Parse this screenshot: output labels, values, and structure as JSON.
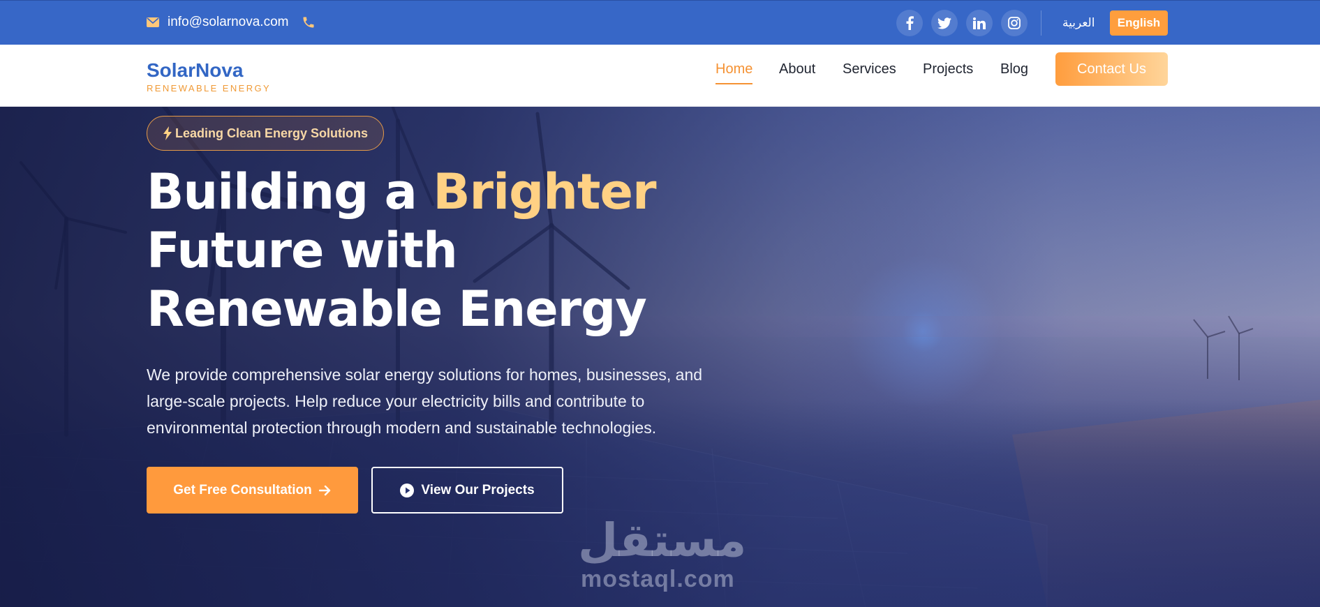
{
  "topbar": {
    "email": "info@solarnova.com",
    "social": [
      "facebook-icon",
      "twitter-icon",
      "linkedin-icon",
      "instagram-icon"
    ],
    "lang_ar": "العربية",
    "lang_en": "English"
  },
  "nav": {
    "logo_name": "SolarNova",
    "logo_tagline": "RENEWABLE ENERGY",
    "links": [
      "Home",
      "About",
      "Services",
      "Projects",
      "Blog"
    ],
    "active": "Home",
    "contact": "Contact Us"
  },
  "hero": {
    "badge": "Leading Clean Energy Solutions",
    "headline_part1": "Building a ",
    "headline_accent": "Brighter",
    "headline_line2": "Future with",
    "headline_line3": "Renewable Energy",
    "description": "We provide comprehensive solar energy solutions for homes, businesses, and large-scale projects. Help reduce your electricity bills and contribute to environmental protection through modern and sustainable technologies.",
    "primary_button": "Get Free Consultation",
    "secondary_button": "View Our Projects"
  },
  "watermark": {
    "arabic": "مستقل",
    "latin": "mostaql.com"
  },
  "colors": {
    "topbar": "#3767c7",
    "accent": "#ff9a3d",
    "headline_accent": "#ffd184",
    "brand": "#3266c4"
  }
}
